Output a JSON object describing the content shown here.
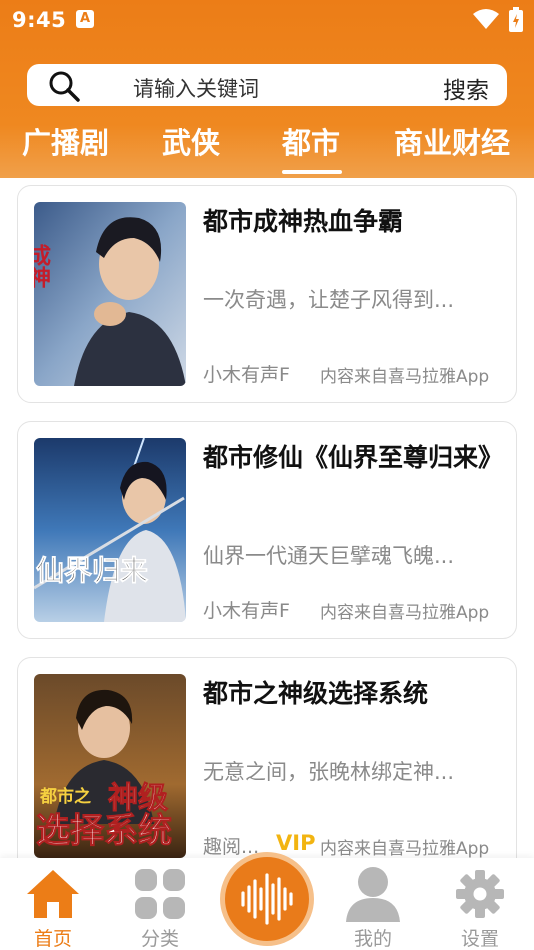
{
  "status": {
    "time": "9:45",
    "app_badge": "A"
  },
  "search": {
    "placeholder": "请输入关键词",
    "button": "搜索"
  },
  "tabs": [
    "广播剧",
    "武侠",
    "都市",
    "商业财经"
  ],
  "active_tab": "都市",
  "books": [
    {
      "title": "都市成神热血争霸",
      "desc": "一次奇遇，让楚子风得到...",
      "author": "小木有声F",
      "vip": "",
      "source": "内容来自喜马拉雅App"
    },
    {
      "title": "都市修仙《仙界至尊归来》",
      "desc": "仙界一代通天巨擘魂飞魄...",
      "author": "小木有声F",
      "vip": "",
      "source": "内容来自喜马拉雅App"
    },
    {
      "title": "都市之神级选择系统",
      "desc": "无意之间，张晚林绑定神...",
      "author": "趣阅...",
      "vip": "VIP",
      "source": "内容来自喜马拉雅App"
    }
  ],
  "cover_texts": {
    "book1": "成神",
    "book2": "仙界归来",
    "book3_top": "都市之",
    "book3_big1": "神级",
    "book3_big2": "选择系统"
  },
  "nav": {
    "home": "首页",
    "category": "分类",
    "mine": "我的",
    "settings": "设置"
  },
  "colors": {
    "accent": "#ec7d17",
    "vip": "#f2b411",
    "active_nav": "#ec7d17",
    "inactive_nav": "#9a9a9a"
  }
}
